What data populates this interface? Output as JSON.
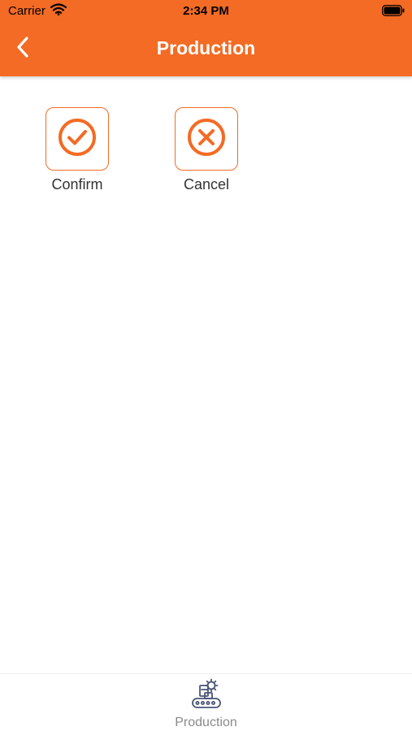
{
  "status_bar": {
    "carrier": "Carrier",
    "time": "2:34 PM"
  },
  "header": {
    "title": "Production",
    "back_icon": "chevron-left-icon"
  },
  "actions": [
    {
      "label": "Confirm",
      "icon": "check-circle-icon"
    },
    {
      "label": "Cancel",
      "icon": "x-circle-icon"
    }
  ],
  "tab_bar": {
    "items": [
      {
        "label": "Production",
        "icon": "conveyor-robot-icon"
      }
    ]
  },
  "colors": {
    "accent": "#f36b24",
    "tab_icon": "#4b5577",
    "tab_label": "#8a8a8a"
  }
}
